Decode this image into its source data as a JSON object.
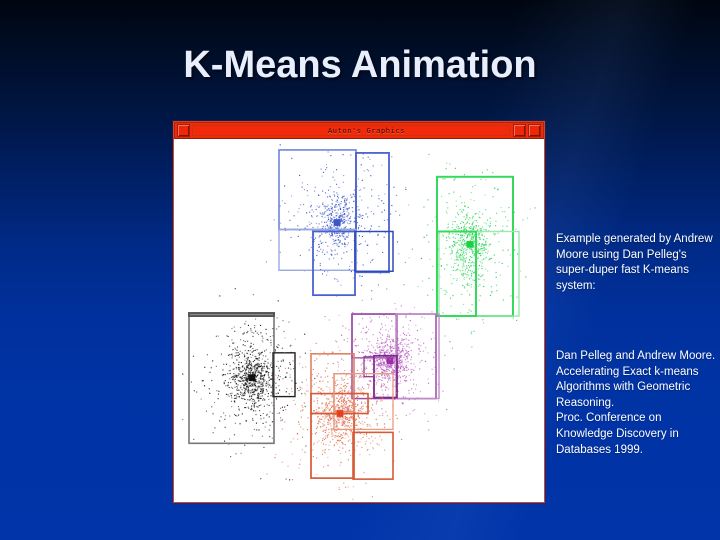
{
  "slide": {
    "title": "K-Means Animation",
    "background_top_color": "#000610",
    "background_bottom_color": "#0034a8",
    "title_color": "#e9eefc"
  },
  "window": {
    "title": "Auton's Graphics",
    "titlebar_color": "#f22a0a",
    "border_color": "#c04a40",
    "canvas_color": "#ffffff",
    "buttons": {
      "menu_label": "",
      "minimize_label": "",
      "maximize_label": ""
    }
  },
  "captions": {
    "paragraph_1": "Example generated by Andrew Moore using Dan Pelleg's super-duper fast K-means system:",
    "paragraph_2": "Dan Pelleg and Andrew Moore. Accelerating Exact k-means Algorithms with Geometric Reasoning.\nProc. Conference on Knowledge Discovery in Databases 1999.",
    "text_color": "#ffffff"
  },
  "chart_data": {
    "type": "scatter",
    "title": "K-Means Animation",
    "xlabel": "",
    "ylabel": "",
    "xlim": [
      0,
      370
    ],
    "ylim": [
      0,
      365
    ],
    "grid": false,
    "legend": null,
    "description": "Five point clusters produced by a k-means run, each drawn in its own color with kd-tree style bounding rectangles and a filled centroid marker.",
    "clusters": [
      {
        "name": "cluster-blue",
        "color": "#3a56c8",
        "point_color": "#3a56c8",
        "n_points": 620,
        "centroid": [
          163,
          84
        ],
        "spread": [
          33,
          40
        ],
        "rects": [
          {
            "x": 105,
            "y": 11,
            "w": 77,
            "h": 80,
            "color": "#6f84d8",
            "width": 1.6
          },
          {
            "x": 182,
            "y": 14,
            "w": 33,
            "h": 120,
            "color": "#4a62cc",
            "width": 1.8
          },
          {
            "x": 105,
            "y": 91,
            "w": 77,
            "h": 41,
            "color": "#9aa8e0",
            "width": 1.4
          },
          {
            "x": 139,
            "y": 93,
            "w": 42,
            "h": 64,
            "color": "#4a62cc",
            "width": 1.8
          },
          {
            "x": 181,
            "y": 93,
            "w": 38,
            "h": 40,
            "color": "#2f49b8",
            "width": 1.5
          }
        ]
      },
      {
        "name": "cluster-green",
        "color": "#18d246",
        "point_color": "#2ad455",
        "n_points": 700,
        "centroid": [
          296,
          106
        ],
        "spread": [
          30,
          46
        ],
        "rects": [
          {
            "x": 263,
            "y": 38,
            "w": 76,
            "h": 140,
            "color": "#35d95c",
            "width": 2.0
          },
          {
            "x": 265,
            "y": 93,
            "w": 80,
            "h": 85,
            "color": "#9be8ad",
            "width": 1.4
          },
          {
            "x": 263,
            "y": 93,
            "w": 39,
            "h": 85,
            "color": "#35d95c",
            "width": 2.0
          }
        ]
      },
      {
        "name": "cluster-black",
        "color": "#111111",
        "point_color": "#1a1a1a",
        "n_points": 900,
        "centroid": [
          78,
          240
        ],
        "spread": [
          30,
          39
        ],
        "rects": [
          {
            "x": 15,
            "y": 176,
            "w": 85,
            "h": 130,
            "color": "#777777",
            "width": 1.6
          },
          {
            "x": 99,
            "y": 215,
            "w": 22,
            "h": 44,
            "color": "#222222",
            "width": 1.4
          },
          {
            "x": 15,
            "y": 175,
            "w": 85,
            "h": 3,
            "color": "#555555",
            "width": 2.0
          }
        ]
      },
      {
        "name": "cluster-magenta",
        "color": "#9b2fa8",
        "point_color": "#b558c0",
        "n_points": 780,
        "centroid": [
          216,
          223
        ],
        "spread": [
          30,
          33
        ],
        "rects": [
          {
            "x": 178,
            "y": 176,
            "w": 45,
            "h": 44,
            "color": "#b06bbb",
            "width": 1.6
          },
          {
            "x": 178,
            "y": 176,
            "w": 84,
            "h": 85,
            "color": "#9a4aa6",
            "width": 1.5
          },
          {
            "x": 222,
            "y": 176,
            "w": 43,
            "h": 85,
            "color": "#c08ccb",
            "width": 1.4
          },
          {
            "x": 200,
            "y": 218,
            "w": 23,
            "h": 42,
            "color": "#7c2a8a",
            "width": 1.8
          },
          {
            "x": 190,
            "y": 219,
            "w": 10,
            "h": 20,
            "color": "#8e3a9c",
            "width": 1.3
          }
        ]
      },
      {
        "name": "cluster-orange",
        "color": "#e8401c",
        "point_color": "#e2704f",
        "n_points": 900,
        "centroid": [
          166,
          276
        ],
        "spread": [
          32,
          42
        ],
        "rects": [
          {
            "x": 137,
            "y": 216,
            "w": 43,
            "h": 125,
            "color": "#e0805f",
            "width": 1.6
          },
          {
            "x": 160,
            "y": 236,
            "w": 20,
            "h": 38,
            "color": "#e08a6b",
            "width": 1.4
          },
          {
            "x": 137,
            "y": 256,
            "w": 57,
            "h": 20,
            "color": "#d65a36",
            "width": 1.6
          },
          {
            "x": 179,
            "y": 295,
            "w": 40,
            "h": 47,
            "color": "#d65a36",
            "width": 1.6
          },
          {
            "x": 160,
            "y": 236,
            "w": 59,
            "h": 56,
            "color": "#e89a7c",
            "width": 1.3
          },
          {
            "x": 137,
            "y": 276,
            "w": 43,
            "h": 65,
            "color": "#d65a36",
            "width": 1.5
          }
        ]
      }
    ]
  }
}
